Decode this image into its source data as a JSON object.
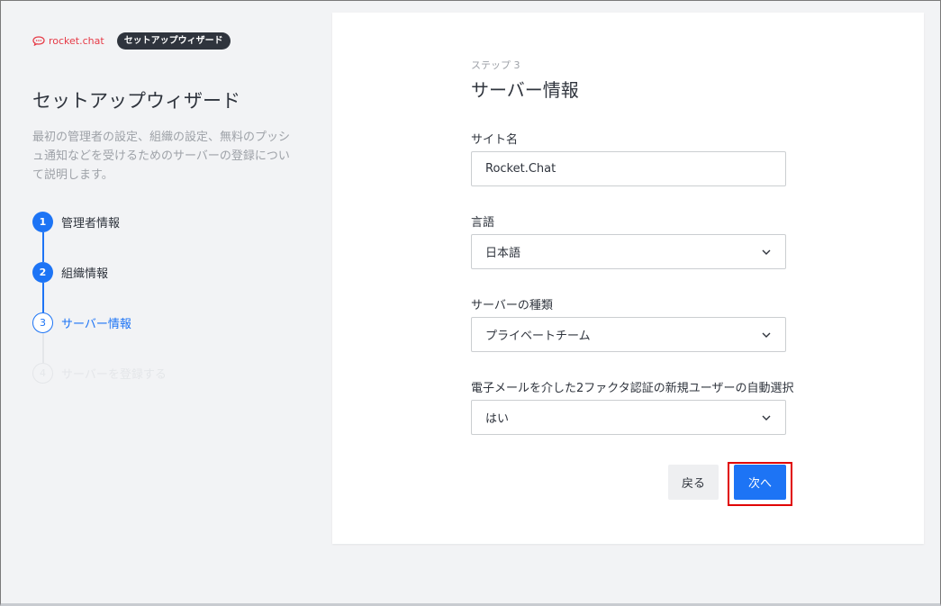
{
  "brand": {
    "logo_text": "rocket.chat",
    "badge": "セットアップウィザード"
  },
  "left": {
    "title": "セットアップウィザード",
    "description": "最初の管理者の設定、組織の設定、無料のプッシュ通知などを受けるためのサーバーの登録について説明します。",
    "steps": [
      {
        "number": "1",
        "label": "管理者情報",
        "state": "done"
      },
      {
        "number": "2",
        "label": "組織情報",
        "state": "done"
      },
      {
        "number": "3",
        "label": "サーバー情報",
        "state": "current"
      },
      {
        "number": "4",
        "label": "サーバーを登録する",
        "state": "todo"
      }
    ]
  },
  "form": {
    "step_label": "ステップ 3",
    "title": "サーバー情報",
    "site_name": {
      "label": "サイト名",
      "value": "Rocket.Chat"
    },
    "language": {
      "label": "言語",
      "value": "日本語"
    },
    "server_type": {
      "label": "サーバーの種類",
      "value": "プライベートチーム"
    },
    "auto_2fa": {
      "label": "電子メールを介した2ファクタ認証の新規ユーザーの自動選択",
      "value": "はい"
    },
    "back_button": "戻る",
    "next_button": "次へ"
  },
  "colors": {
    "primary": "#1d74f5",
    "brand_red": "#e63a46",
    "highlight": "#e00000"
  }
}
